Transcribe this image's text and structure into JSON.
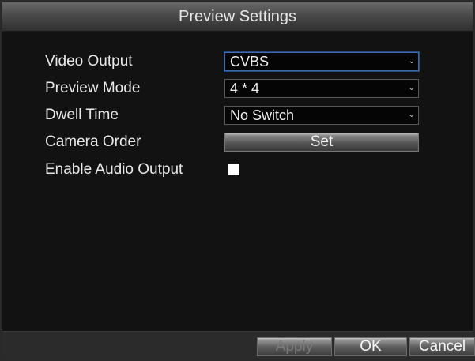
{
  "dialog": {
    "title": "Preview Settings"
  },
  "fields": {
    "video_output": {
      "label": "Video Output",
      "value": "CVBS",
      "arrow_icon": "dropdown-arrow-icon"
    },
    "preview_mode": {
      "label": "Preview Mode",
      "value": "4 * 4",
      "arrow_icon": "dropdown-arrow-icon"
    },
    "dwell_time": {
      "label": "Dwell Time",
      "value": "No Switch",
      "arrow_icon": "dropdown-arrow-icon"
    },
    "camera_order": {
      "label": "Camera Order",
      "button_label": "Set"
    },
    "enable_audio": {
      "label": "Enable Audio Output",
      "checked": false
    }
  },
  "buttons": {
    "apply": "Apply",
    "ok": "OK",
    "cancel": "Cancel"
  },
  "colors": {
    "focus_border": "#3b6fb5",
    "background": "#121212"
  }
}
